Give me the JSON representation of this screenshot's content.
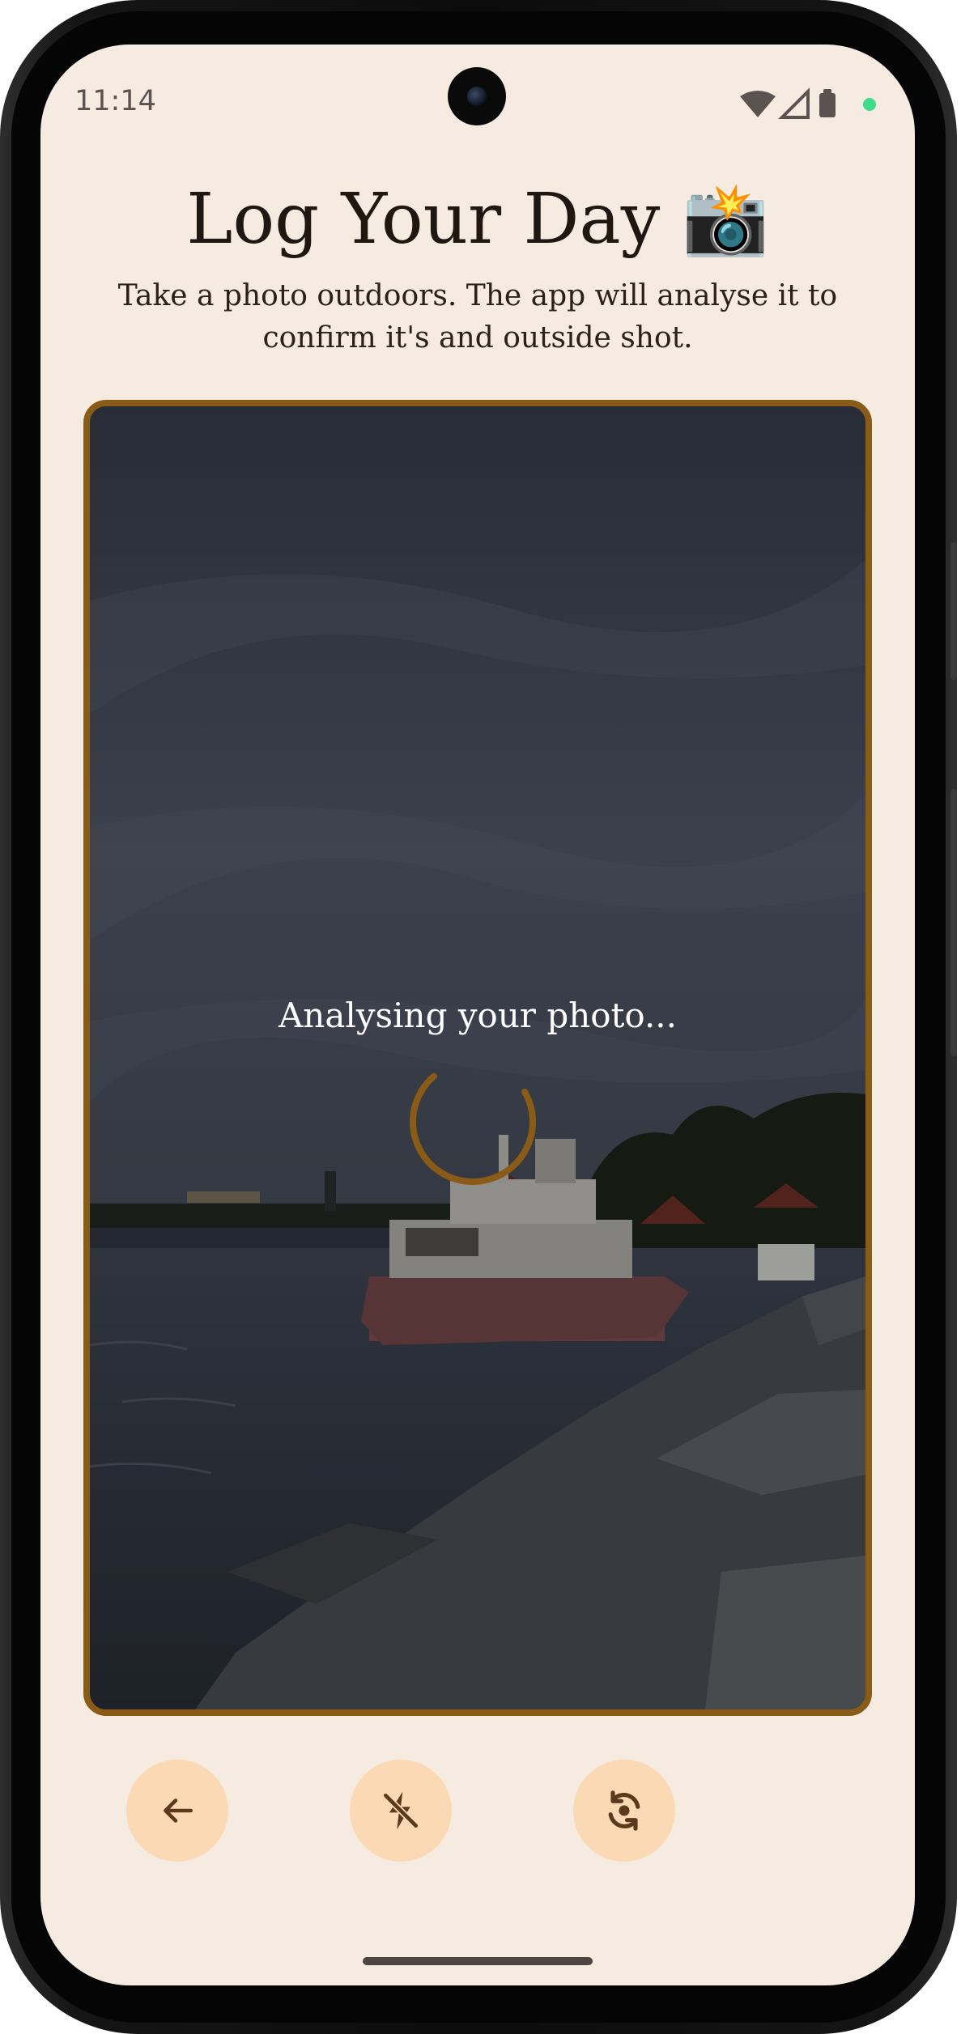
{
  "status_bar": {
    "time": "11:14"
  },
  "header": {
    "title": "Log Your Day 📸",
    "subtitle": "Take a photo outdoors. The app will analyse it to confirm it's and outside shot."
  },
  "preview": {
    "status_text": "Analysing your photo...",
    "frame_color": "#8a5a17"
  },
  "controls": {
    "back_icon": "arrow-left-icon",
    "flash_icon": "flash-off-icon",
    "switch_camera_icon": "camera-flip-icon",
    "button_color": "#fcd9b5",
    "icon_color": "#5a3a1c"
  },
  "theme": {
    "background": "#f6ebe0",
    "text": "#1e1712"
  }
}
